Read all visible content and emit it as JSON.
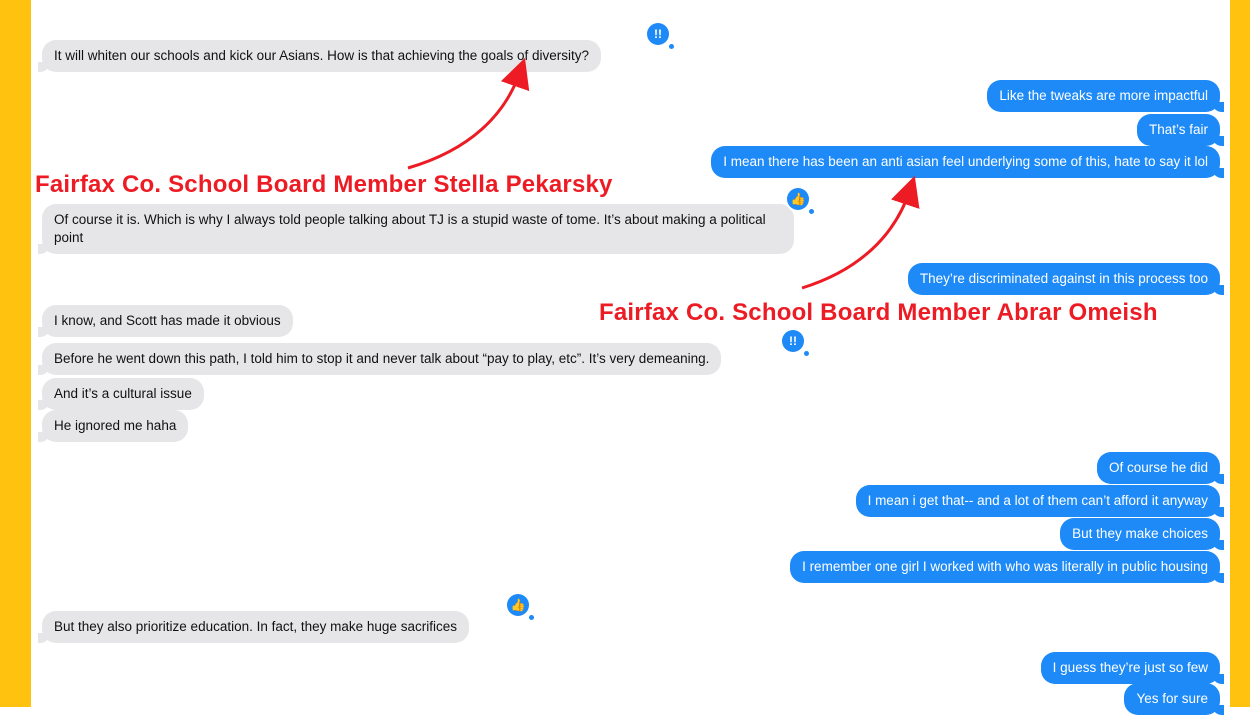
{
  "theme": {
    "frame": "#FFC20E",
    "sent": "#1d8af7",
    "received": "#e6e6e8",
    "annotation": "#ed1c24"
  },
  "annotations": {
    "left": "Fairfax Co. School Board Member Stella Pekarsky",
    "right": "Fairfax Co. School Board Member Abrar Omeish"
  },
  "messages": [
    {
      "side": "received",
      "text": "It will whiten our schools and kick our Asians. How is that achieving the goals of diversity?",
      "reaction": "exclamation-icon"
    },
    {
      "side": "sent",
      "text": "Like the tweaks are more impactful"
    },
    {
      "side": "sent",
      "text": "That’s fair"
    },
    {
      "side": "sent",
      "text": "I mean there has been an anti asian feel underlying some of this, hate to say it lol"
    },
    {
      "side": "received",
      "text": "Of course it is. Which is why I always told people talking about TJ is a stupid waste of tome. It’s about making a political point",
      "reaction": "thumbs-up-icon"
    },
    {
      "side": "sent",
      "text": "They’re discriminated against in this process too"
    },
    {
      "side": "received",
      "text": "I know, and Scott has made it obvious"
    },
    {
      "side": "received",
      "text": "Before he went down this path, I told him to stop it and never talk about “pay to play, etc”. It’s very demeaning.",
      "reaction": "exclamation-icon"
    },
    {
      "side": "received",
      "text": "And it’s a cultural issue"
    },
    {
      "side": "received",
      "text": "He ignored me haha"
    },
    {
      "side": "sent",
      "text": "Of course he did"
    },
    {
      "side": "sent",
      "text": "I mean i get that-- and a lot of them can’t afford it anyway"
    },
    {
      "side": "sent",
      "text": "But they make choices"
    },
    {
      "side": "sent",
      "text": "I remember one girl I worked with who was literally in public housing"
    },
    {
      "side": "received",
      "text": "But they also prioritize education. In fact, they make huge sacrifices",
      "reaction": "thumbs-up-icon"
    },
    {
      "side": "sent",
      "text": "I guess they’re just so few"
    },
    {
      "side": "sent",
      "text": "Yes for sure"
    }
  ]
}
